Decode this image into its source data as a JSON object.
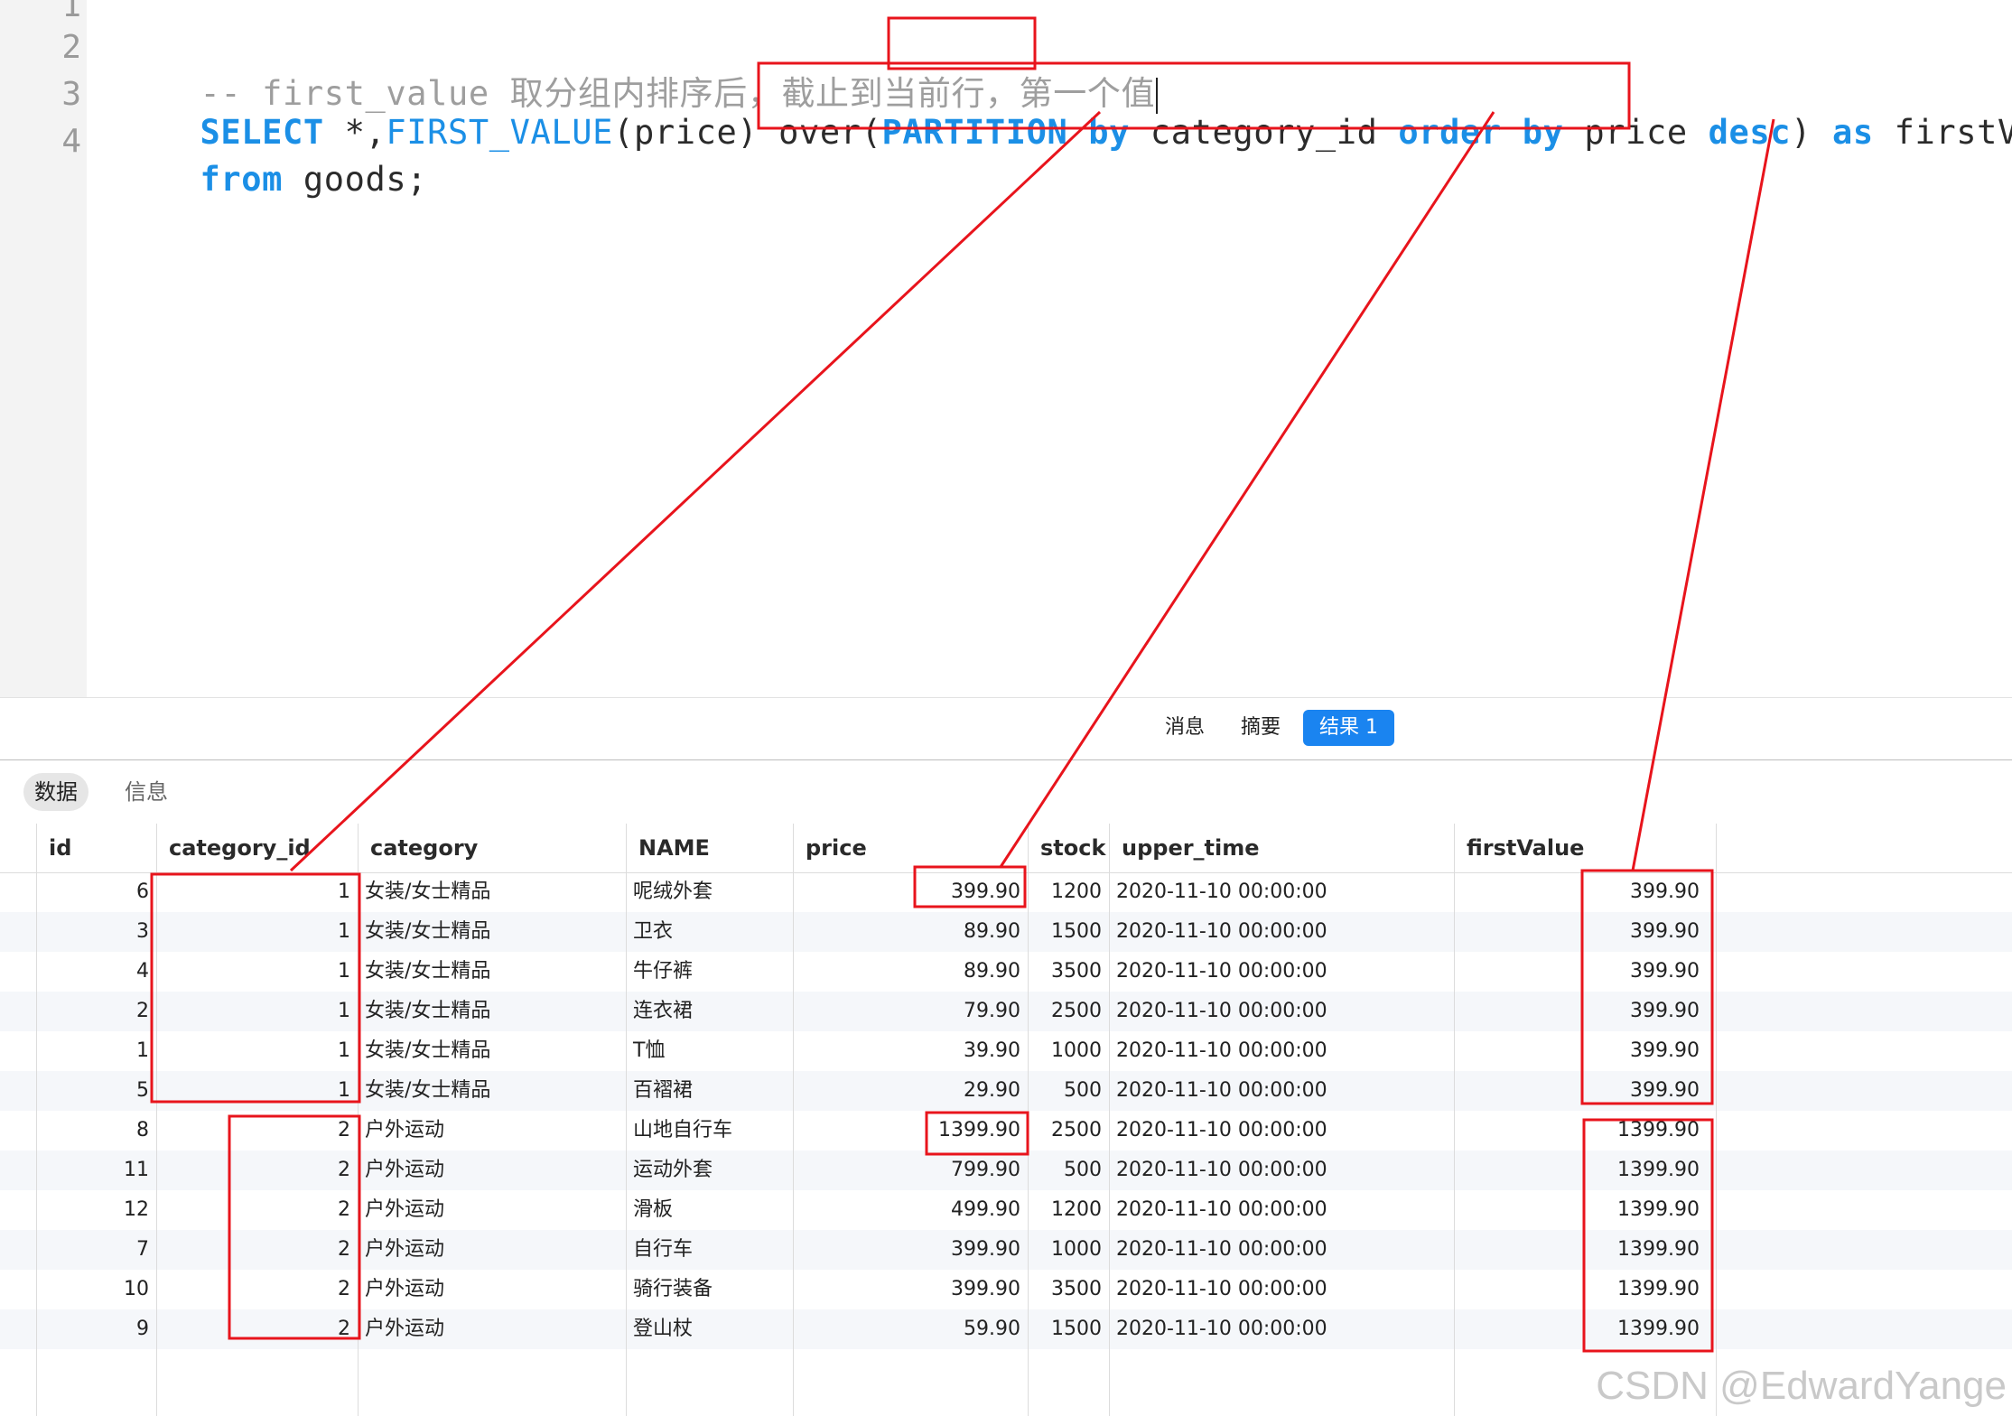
{
  "editor": {
    "line_numbers": [
      "1",
      "2",
      "3",
      "4"
    ],
    "line2": {
      "comment": "-- first_value 取分组内排序后，截止到当前行，第一个值"
    },
    "line3": {
      "kw_select": "SELECT",
      "star": " *,",
      "fn_first_value": "FIRST_VALUE",
      "args": "(price) over(",
      "kw_partition": "PARTITION",
      "kw_by1": "by",
      "col_category": "category_id",
      "kw_order": "order",
      "kw_by2": "by",
      "col_price": "price",
      "kw_desc": "desc",
      "close": ")",
      "kw_as": "as",
      "alias": "firstValue"
    },
    "line4": {
      "kw_from": "from",
      "rest": " goods;"
    }
  },
  "result_tabs": {
    "messages": "消息",
    "summary": "摘要",
    "result1": "结果 1"
  },
  "sub_tabs": {
    "data": "数据",
    "info": "信息"
  },
  "grid": {
    "columns": [
      "id",
      "category_id",
      "category",
      "NAME",
      "price",
      "stock",
      "upper_time",
      "firstValue"
    ],
    "rows": [
      {
        "id": "6",
        "category_id": "1",
        "category": "女装/女士精品",
        "name": "呢绒外套",
        "price": "399.90",
        "stock": "1200",
        "upper_time": "2020-11-10 00:00:00",
        "first_value": "399.90"
      },
      {
        "id": "3",
        "category_id": "1",
        "category": "女装/女士精品",
        "name": "卫衣",
        "price": "89.90",
        "stock": "1500",
        "upper_time": "2020-11-10 00:00:00",
        "first_value": "399.90"
      },
      {
        "id": "4",
        "category_id": "1",
        "category": "女装/女士精品",
        "name": "牛仔裤",
        "price": "89.90",
        "stock": "3500",
        "upper_time": "2020-11-10 00:00:00",
        "first_value": "399.90"
      },
      {
        "id": "2",
        "category_id": "1",
        "category": "女装/女士精品",
        "name": "连衣裙",
        "price": "79.90",
        "stock": "2500",
        "upper_time": "2020-11-10 00:00:00",
        "first_value": "399.90"
      },
      {
        "id": "1",
        "category_id": "1",
        "category": "女装/女士精品",
        "name": "T恤",
        "price": "39.90",
        "stock": "1000",
        "upper_time": "2020-11-10 00:00:00",
        "first_value": "399.90"
      },
      {
        "id": "5",
        "category_id": "1",
        "category": "女装/女士精品",
        "name": "百褶裙",
        "price": "29.90",
        "stock": "500",
        "upper_time": "2020-11-10 00:00:00",
        "first_value": "399.90"
      },
      {
        "id": "8",
        "category_id": "2",
        "category": "户外运动",
        "name": "山地自行车",
        "price": "1399.90",
        "stock": "2500",
        "upper_time": "2020-11-10 00:00:00",
        "first_value": "1399.90"
      },
      {
        "id": "11",
        "category_id": "2",
        "category": "户外运动",
        "name": "运动外套",
        "price": "799.90",
        "stock": "500",
        "upper_time": "2020-11-10 00:00:00",
        "first_value": "1399.90"
      },
      {
        "id": "12",
        "category_id": "2",
        "category": "户外运动",
        "name": "滑板",
        "price": "499.90",
        "stock": "1200",
        "upper_time": "2020-11-10 00:00:00",
        "first_value": "1399.90"
      },
      {
        "id": "7",
        "category_id": "2",
        "category": "户外运动",
        "name": "自行车",
        "price": "399.90",
        "stock": "1000",
        "upper_time": "2020-11-10 00:00:00",
        "first_value": "1399.90"
      },
      {
        "id": "10",
        "category_id": "2",
        "category": "户外运动",
        "name": "骑行装备",
        "price": "399.90",
        "stock": "3500",
        "upper_time": "2020-11-10 00:00:00",
        "first_value": "1399.90"
      },
      {
        "id": "9",
        "category_id": "2",
        "category": "户外运动",
        "name": "登山杖",
        "price": "59.90",
        "stock": "1500",
        "upper_time": "2020-11-10 00:00:00",
        "first_value": "1399.90"
      }
    ]
  },
  "annotation_color": "#e8141c",
  "accent_color": "#1a84f0",
  "watermark": "CSDN @EdwardYange"
}
